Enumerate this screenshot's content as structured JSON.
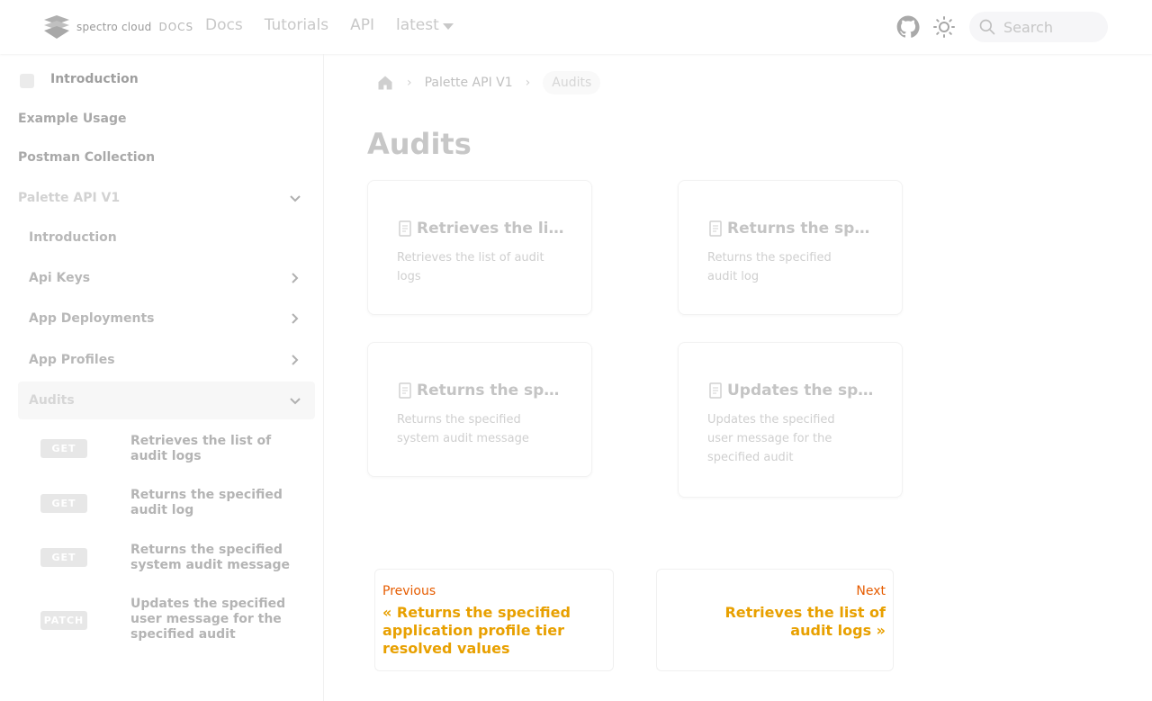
{
  "brand": {
    "name": "spectro cloud",
    "suffix": "DOCS"
  },
  "nav": {
    "links": [
      "Docs",
      "Tutorials",
      "API"
    ],
    "version": "latest",
    "search_placeholder": "Search"
  },
  "sidebar": {
    "top_intro": "Introduction",
    "items": [
      {
        "label": "Example Usage"
      },
      {
        "label": "Postman Collection"
      },
      {
        "label": "Palette API V1"
      },
      {
        "label": "Introduction"
      },
      {
        "label": "Api Keys"
      },
      {
        "label": "App Deployments"
      },
      {
        "label": "App Profiles"
      },
      {
        "label": "Audits"
      }
    ],
    "endpoints": [
      {
        "method": "GET",
        "label": "Retrieves the list of audit logs"
      },
      {
        "method": "GET",
        "label": "Returns the specified audit log"
      },
      {
        "method": "GET",
        "label": "Returns the specified system audit message"
      },
      {
        "method": "PATCH",
        "label": "Updates the specified user message for the specified audit"
      }
    ]
  },
  "breadcrumb": {
    "parent": "Palette API V1",
    "current": "Audits"
  },
  "page": {
    "title": "Audits"
  },
  "cards": [
    {
      "title": "Retrieves the list of audit logs",
      "desc": "Retrieves the list of audit logs"
    },
    {
      "title": "Returns the specified audit log",
      "desc": "Returns the specified audit log"
    },
    {
      "title": "Returns the specified system audit message",
      "desc": "Returns the specified system audit message"
    },
    {
      "title": "Updates the specified user message for the specified audit",
      "desc": "Updates the specified user message for the specified audit"
    }
  ],
  "pagination": {
    "prev_sub": "Previous",
    "prev_title": "« Returns the specified application profile tier resolved values",
    "next_sub": "Next",
    "next_title": "Retrieves the list of audit logs »"
  },
  "colors": {
    "accent_orange": "#e65c00",
    "accent_yellow": "#e8a000"
  }
}
